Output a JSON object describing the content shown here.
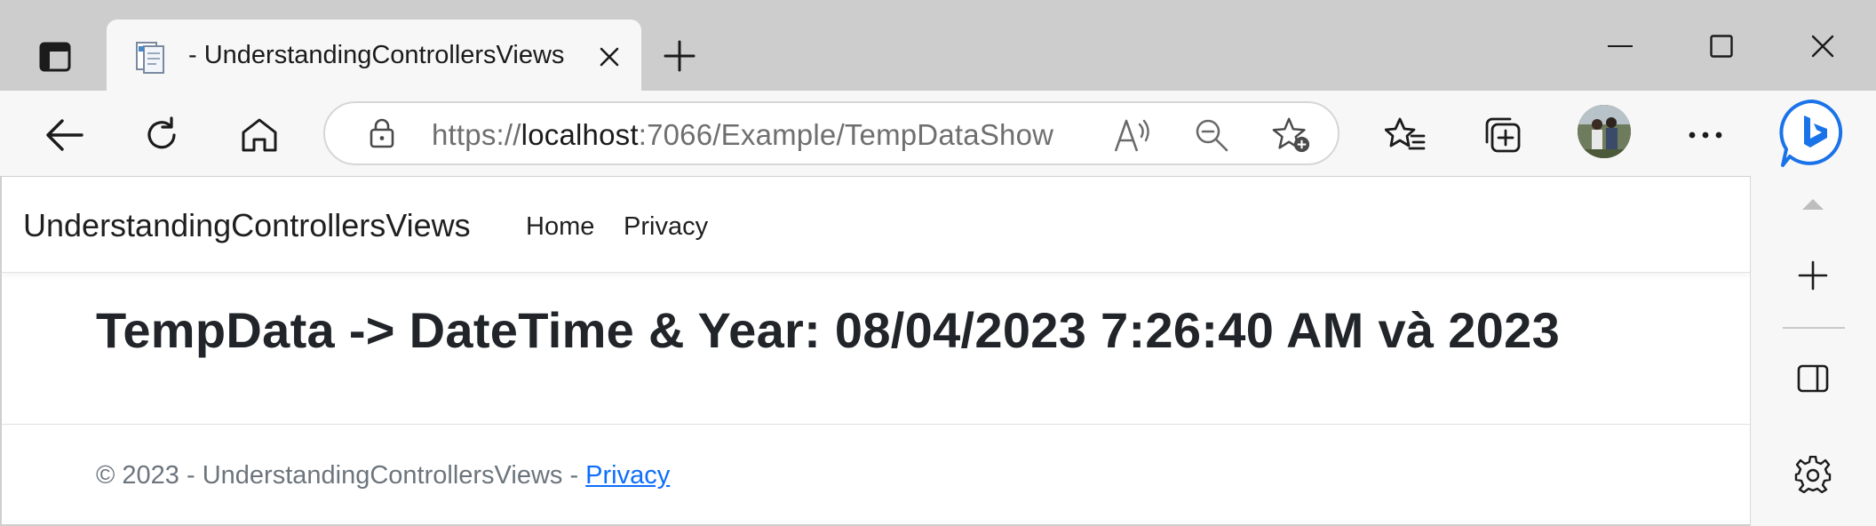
{
  "tab": {
    "title": "- UnderstandingControllersViews",
    "favicon": "page-icon"
  },
  "address": {
    "scheme": "https://",
    "host": "localhost",
    "rest": ":7066/Example/TempDataShow"
  },
  "toolbar_icons": [
    "back-icon",
    "refresh-icon",
    "home-icon",
    "read-aloud-icon",
    "zoom-out-icon",
    "add-favorite-icon",
    "favorites-icon",
    "collections-icon",
    "profile-avatar",
    "more-icon",
    "bing-icon"
  ],
  "site": {
    "brand": "UnderstandingControllersViews",
    "nav": [
      "Home",
      "Privacy"
    ],
    "heading": "TempData -> DateTime & Year: 08/04/2023 7:26:40 AM và 2023",
    "footer": {
      "text": "© 2023 - UnderstandingControllersViews - ",
      "link": "Privacy"
    }
  },
  "colors": {
    "link": "#0d6efd",
    "bing_blue": "#1a73e8",
    "chrome_bg": "#cdcdcd"
  }
}
